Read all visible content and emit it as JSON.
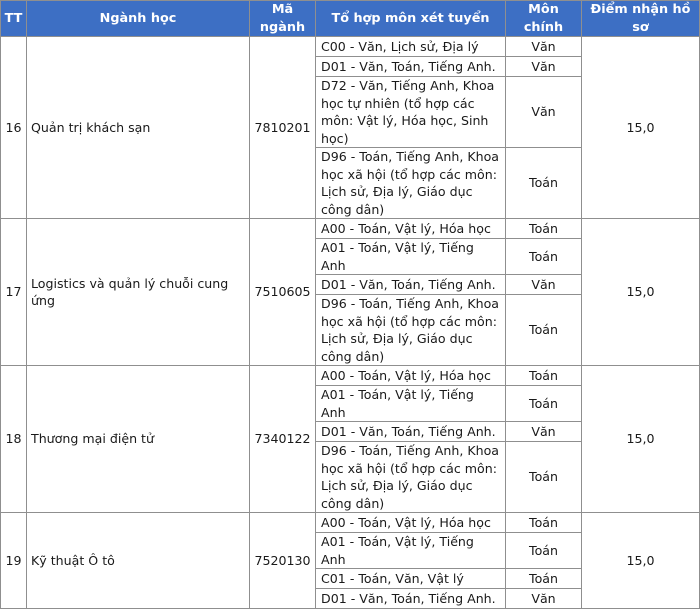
{
  "headers": {
    "tt": "TT",
    "major": "Ngành học",
    "code": "Mã ngành",
    "combo": "Tổ hợp môn xét tuyển",
    "main_subject": "Môn chính",
    "score": "Điểm nhận hồ sơ"
  },
  "rows": [
    {
      "tt": "16",
      "major": "Quản trị khách sạn",
      "code": "7810201",
      "score": "15,0",
      "combos": [
        {
          "combo": "C00 - Văn, Lịch sử, Địa lý",
          "main": "Văn"
        },
        {
          "combo": "D01 - Văn, Toán, Tiếng Anh.",
          "main": "Văn"
        },
        {
          "combo": "D72 - Văn, Tiếng Anh, Khoa học tự nhiên (tổ hợp các môn: Vật lý, Hóa học, Sinh học)",
          "main": "Văn"
        },
        {
          "combo": "D96 - Toán, Tiếng Anh, Khoa học xã hội (tổ hợp các môn: Lịch sử, Địa lý, Giáo dục công dân)",
          "main": "Toán"
        }
      ]
    },
    {
      "tt": "17",
      "major": "Logistics và quản lý chuỗi cung ứng",
      "code": "7510605",
      "score": "15,0",
      "combos": [
        {
          "combo": "A00 - Toán, Vật lý, Hóa học",
          "main": "Toán"
        },
        {
          "combo": "A01 - Toán, Vật lý, Tiếng Anh",
          "main": "Toán"
        },
        {
          "combo": "D01 - Văn, Toán, Tiếng Anh.",
          "main": "Văn"
        },
        {
          "combo": "D96 - Toán, Tiếng Anh, Khoa học xã hội (tổ hợp các môn: Lịch sử, Địa lý, Giáo dục công dân)",
          "main": "Toán"
        }
      ]
    },
    {
      "tt": "18",
      "major": "Thương mại điện tử",
      "code": "7340122",
      "score": "15,0",
      "combos": [
        {
          "combo": "A00 - Toán, Vật lý, Hóa học",
          "main": "Toán"
        },
        {
          "combo": "A01 - Toán, Vật lý, Tiếng Anh",
          "main": "Toán"
        },
        {
          "combo": "D01 - Văn, Toán, Tiếng Anh.",
          "main": "Văn"
        },
        {
          "combo": "D96 - Toán, Tiếng Anh, Khoa học xã hội (tổ hợp các môn: Lịch sử, Địa lý, Giáo dục công dân)",
          "main": "Toán"
        }
      ]
    },
    {
      "tt": "19",
      "major": "Kỹ thuật Ô tô",
      "code": "7520130",
      "score": "15,0",
      "combos": [
        {
          "combo": "A00 - Toán, Vật lý, Hóa học",
          "main": "Toán"
        },
        {
          "combo": "A01 - Toán, Vật lý, Tiếng Anh",
          "main": "Toán"
        },
        {
          "combo": "C01 - Toán, Văn, Vật lý",
          "main": "Toán"
        },
        {
          "combo": "D01 - Văn, Toán, Tiếng Anh.",
          "main": "Văn"
        }
      ]
    }
  ]
}
